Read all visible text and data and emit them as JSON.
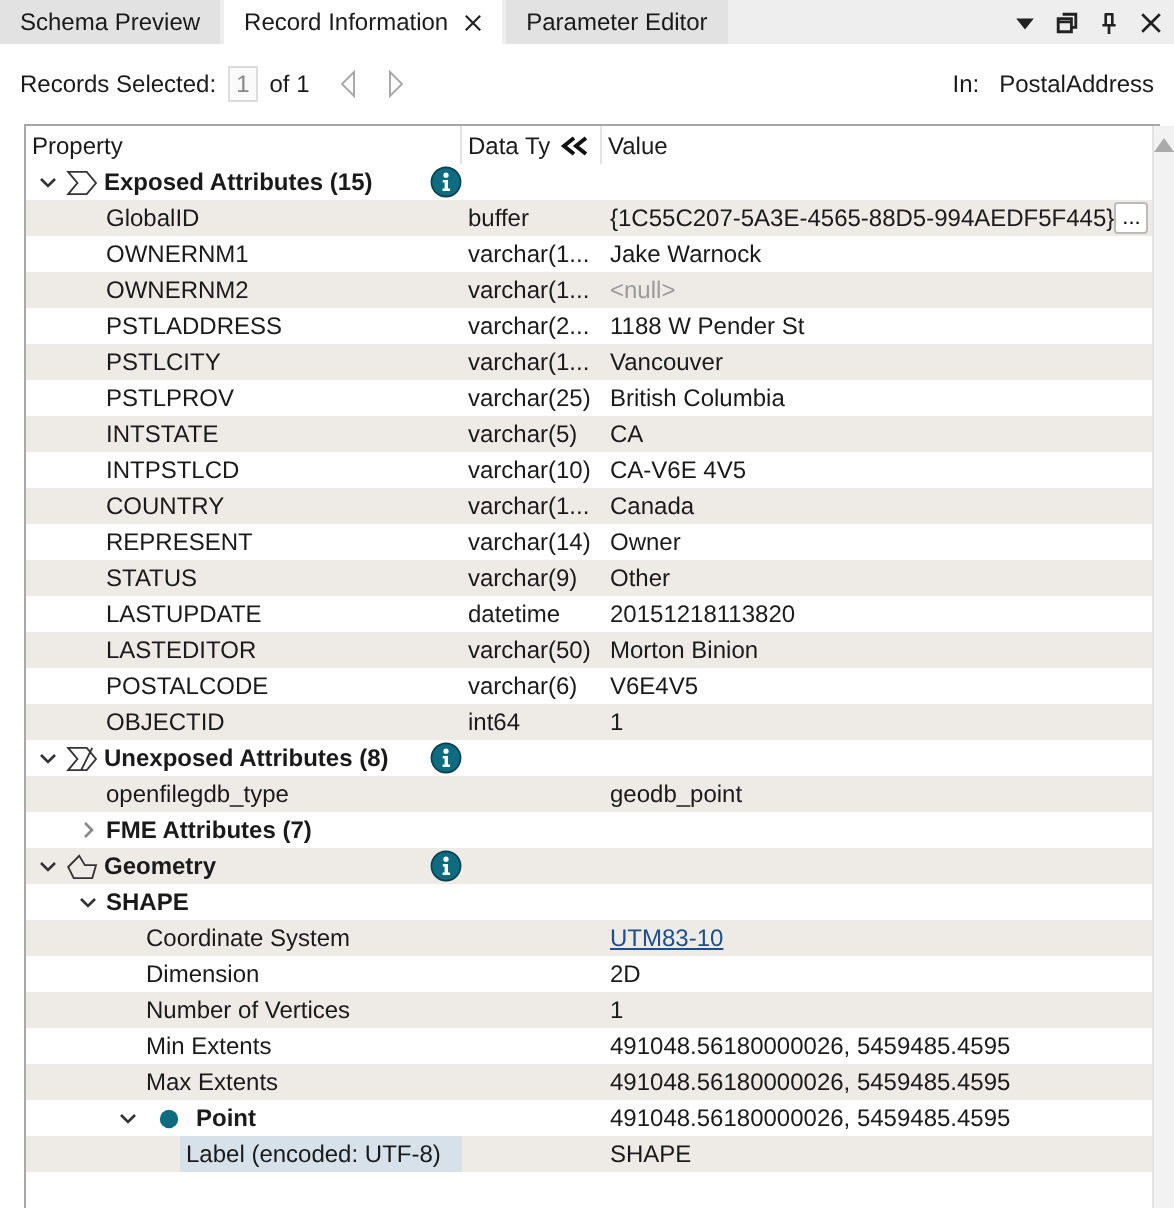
{
  "tabs": [
    {
      "label": "Schema Preview",
      "selected": false,
      "closable": false
    },
    {
      "label": "Record Information",
      "selected": true,
      "closable": true
    },
    {
      "label": "Parameter Editor",
      "selected": false,
      "closable": false
    }
  ],
  "records": {
    "label": "Records Selected:",
    "current": "1",
    "total": "of 1",
    "source_label": "In:",
    "source": "PostalAddress"
  },
  "table": {
    "columns": [
      "Property",
      "Data Ty",
      "Value"
    ],
    "rows": [
      {
        "kind": "exposed",
        "label": "Exposed Attributes (15)",
        "expanded": true,
        "info": true,
        "children": [
          {
            "kind": "field",
            "name": "GlobalID",
            "type": "buffer",
            "value": "{1C55C207-5A3E-4565-88D5-994AEDF5F445}",
            "more": "...",
            "selected": false
          },
          {
            "kind": "field",
            "name": "OWNERNM1",
            "type": "varchar(1...",
            "value": "Jake Warnock",
            "selected": false
          },
          {
            "kind": "null",
            "name": "OWNERNM2",
            "type": "varchar(1...",
            "value": "<null>",
            "selected": false
          },
          {
            "kind": "field",
            "name": "PSTLADDRESS",
            "type": "varchar(2...",
            "value": "1188 W Pender St",
            "selected": false
          },
          {
            "kind": "field",
            "name": "PSTLCITY",
            "type": "varchar(1...",
            "value": "Vancouver",
            "selected": false
          },
          {
            "kind": "field",
            "name": "PSTLPROV",
            "type": "varchar(25)",
            "value": "British Columbia",
            "selected": false
          },
          {
            "kind": "field",
            "name": "INTSTATE",
            "type": "varchar(5)",
            "value": "CA",
            "selected": false
          },
          {
            "kind": "field",
            "name": "INTPSTLCD",
            "type": "varchar(10)",
            "value": "CA-V6E 4V5",
            "selected": false
          },
          {
            "kind": "field",
            "name": "COUNTRY",
            "type": "varchar(1...",
            "value": "Canada",
            "selected": false
          },
          {
            "kind": "field",
            "name": "REPRESENT",
            "type": "varchar(14)",
            "value": "Owner",
            "selected": false
          },
          {
            "kind": "field",
            "name": "STATUS",
            "type": "varchar(9)",
            "value": "Other",
            "selected": false
          },
          {
            "kind": "field",
            "name": "LASTUPDATE",
            "type": "datetime",
            "value": "20151218113820",
            "selected": false
          },
          {
            "kind": "field",
            "name": "LASTEDITOR",
            "type": "varchar(50)",
            "value": "Morton Binion",
            "selected": false
          },
          {
            "kind": "field",
            "name": "POSTALCODE",
            "type": "varchar(6)",
            "value": "V6E4V5",
            "selected": false
          },
          {
            "kind": "field",
            "name": "OBJECTID",
            "type": "int64",
            "value": "1",
            "selected": false
          }
        ]
      },
      {
        "kind": "unexposed",
        "label": "Unexposed Attributes (8)",
        "expanded": true,
        "info": true,
        "children": [
          {
            "kind": "field",
            "name": "openfilegdb_type",
            "value": "geodb_point",
            "selected": false
          },
          {
            "kind": "group",
            "label": "FME Attributes (7)",
            "expanded": false,
            "info": false
          }
        ]
      },
      {
        "kind": "geometry",
        "label": "Geometry",
        "expanded": true,
        "info": true,
        "children": [
          {
            "kind": "group",
            "label": "SHAPE",
            "expanded": true,
            "info": false,
            "children": [
              {
                "kind": "link",
                "name": "Coordinate System",
                "value": "UTM83-10",
                "selected": false
              },
              {
                "kind": "field",
                "name": "Dimension",
                "value": "2D",
                "selected": false
              },
              {
                "kind": "field",
                "name": "Number of Vertices",
                "value": "1",
                "selected": false
              },
              {
                "kind": "field",
                "name": "Min Extents",
                "value": "491048.56180000026, 5459485.4595",
                "selected": false
              },
              {
                "kind": "field",
                "name": "Max Extents",
                "value": "491048.56180000026, 5459485.4595",
                "selected": false
              },
              {
                "kind": "point",
                "label": "Point",
                "expanded": true,
                "info": false,
                "value": "491048.56180000026, 5459485.4595",
                "children": [
                  {
                    "kind": "field",
                    "name": "Label (encoded: UTF-8)",
                    "value": "SHAPE",
                    "selected": true
                  }
                ]
              }
            ]
          }
        ]
      }
    ]
  }
}
